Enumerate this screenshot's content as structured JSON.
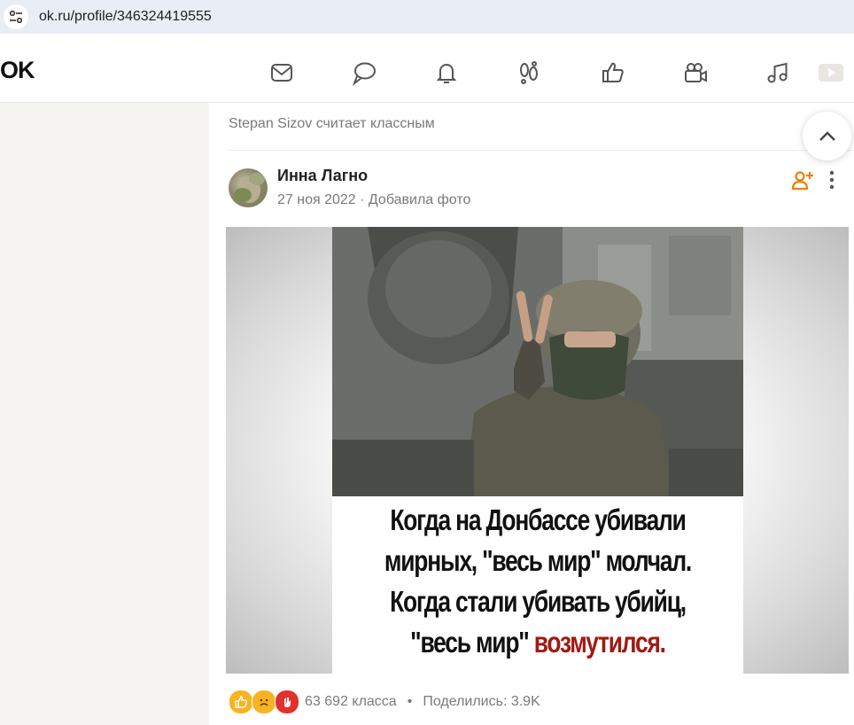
{
  "browser": {
    "url": "ok.ru/profile/346324419555"
  },
  "header": {
    "logo": "OK",
    "nav_icons": [
      "mail-icon",
      "chat-icon",
      "bell-icon",
      "guests-icon",
      "like-icon",
      "video-icon",
      "music-icon",
      "games-icon"
    ]
  },
  "post": {
    "reason": "Stepan Sizov считает классным",
    "author": "Инна Лагно",
    "meta": "27 ноя 2022 · Добавила фото",
    "caption": {
      "line1": "Когда на Донбассе убивали",
      "line2": "мирных, \"весь мир\" молчал.",
      "line3": "Когда стали убивать убийц,",
      "line4_black": "\"весь мир\"",
      "line4_red": "возмутился."
    },
    "footer": {
      "likes": "63 692 класса",
      "separator": "•",
      "shares": "Поделились: 3.9K"
    }
  },
  "colors": {
    "accent": "#ee8208",
    "red_text": "#a11a14",
    "muted": "#7a7a7a"
  }
}
